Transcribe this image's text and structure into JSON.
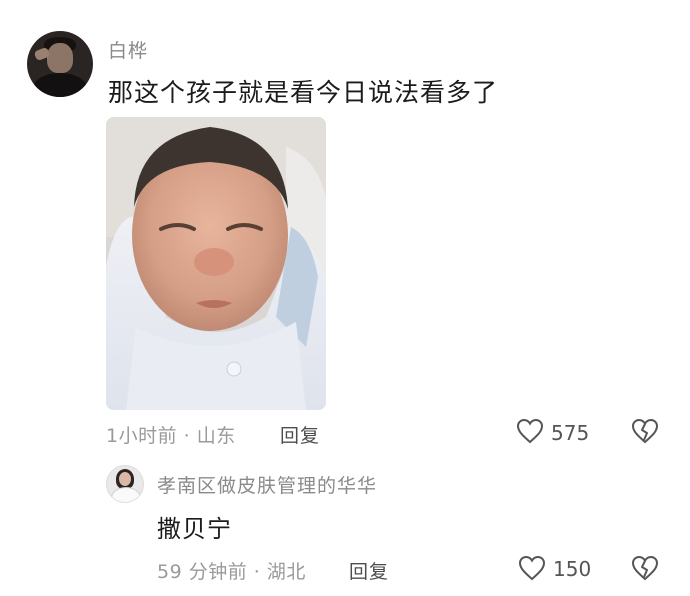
{
  "comment": {
    "username": "白桦",
    "text": "那这个孩子就是看今日说法看多了",
    "time_location": "1小时前 · 山东",
    "reply_label": "回复",
    "like_count": "575"
  },
  "reply": {
    "username": "孝南区做皮肤管理的华华",
    "text": "撒贝宁",
    "time_location": "59 分钟前 · 湖北",
    "reply_label": "回复",
    "like_count": "150"
  },
  "icons": {
    "like": "heart-outline-icon",
    "dislike": "broken-heart-icon"
  },
  "colors": {
    "background": "#ffffff",
    "text_primary": "#1b1b1b",
    "text_secondary": "#9a9a9a",
    "icon": "#555555"
  }
}
